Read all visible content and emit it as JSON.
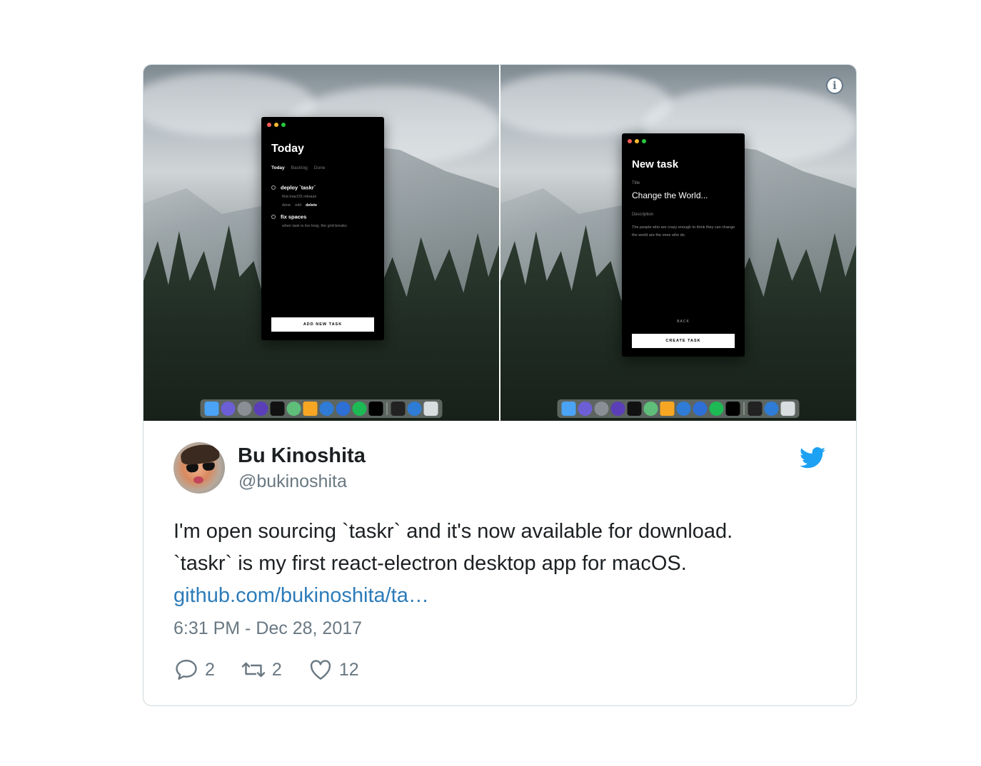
{
  "media": {
    "left_app": {
      "title": "Today",
      "tabs": [
        "Today",
        "Backlog",
        "Done"
      ],
      "tasks": [
        {
          "name": "deploy `taskr`",
          "detail": "first macOS release",
          "actions": [
            "done",
            "edit",
            "delete"
          ]
        },
        {
          "name": "fix spaces",
          "detail": "when task is too long, the grid breaks"
        }
      ],
      "button": "ADD NEW TASK"
    },
    "right_app": {
      "title": "New task",
      "title_label": "Title",
      "title_value": "Change the World...",
      "description_label": "Description",
      "description_value": "The people who are crazy enough to think they can change the world are the ones who do.",
      "back_link": "BACK",
      "button": "CREATE TASK"
    },
    "info_icon": "i"
  },
  "tweet": {
    "author_name": "Bu Kinoshita",
    "author_handle": "@bukinoshita",
    "text_line1": "I'm open sourcing `taskr` and it's now available for download.",
    "text_line2": "`taskr` is my first react-electron desktop app for macOS.",
    "link": "github.com/bukinoshita/ta…",
    "timestamp": "6:31 PM - Dec 28, 2017",
    "replies": "2",
    "retweets": "2",
    "likes": "12"
  },
  "colors": {
    "link": "#2b7bb9",
    "secondary_text": "#697882",
    "twitter_blue": "#1da1f2",
    "border": "#cfd9de"
  },
  "icons": [
    "info-icon",
    "twitter-bird-icon",
    "reply-icon",
    "retweet-icon",
    "like-icon"
  ]
}
